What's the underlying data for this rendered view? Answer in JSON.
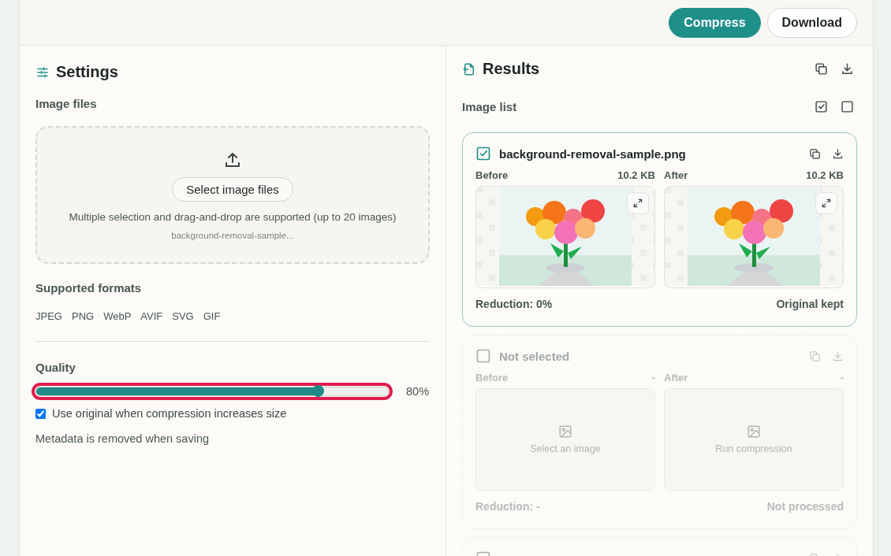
{
  "toolbar": {
    "buttons": [
      {
        "label": "Compress",
        "kind": "primary"
      },
      {
        "label": "Download",
        "kind": "secondary"
      }
    ]
  },
  "settings": {
    "title": "Settings",
    "image_files": {
      "heading": "Image files",
      "button": "Select image files",
      "hint": "Multiple selection and drag-and-drop are supported (up to 20 images)",
      "file_name": "background-removal-sample..."
    },
    "formats": {
      "heading": "Supported formats",
      "items": [
        "JPEG",
        "PNG",
        "WebP",
        "AVIF",
        "SVG",
        "GIF"
      ]
    },
    "quality": {
      "heading": "Quality",
      "level": 0.8,
      "reading": "80%",
      "focused": true
    },
    "option": {
      "label": "Use original when compression increases size",
      "checked": true
    },
    "note": "Metadata is removed when saving"
  },
  "results": {
    "title": "Results",
    "list_heading": "Image list",
    "cards": [
      {
        "title": "background-removal-sample.png",
        "checked": true,
        "before": {
          "label": "Before",
          "size": "10.2 KB",
          "kind": "picture"
        },
        "after": {
          "label": "After",
          "size": "10.2 KB",
          "kind": "picture"
        },
        "reduction": "Reduction: 0%",
        "status": "Original kept"
      },
      {
        "title": "Not selected",
        "checked": false,
        "before": {
          "label": "Before",
          "size": "-",
          "kind": "empty",
          "message": "Select an image"
        },
        "after": {
          "label": "After",
          "size": "-",
          "kind": "empty",
          "message": "Run compression"
        },
        "reduction": "Reduction: -",
        "status": "Not processed"
      },
      {
        "checked": false
      }
    ]
  }
}
